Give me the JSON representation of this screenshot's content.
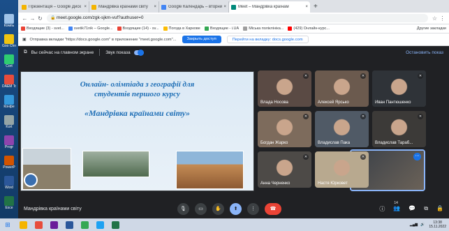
{
  "desktop": {
    "icons": [
      {
        "label": "Компь",
        "color": "#9fc3e8"
      },
      {
        "label": "Goo Chro",
        "color": "#f1c40f"
      },
      {
        "label": "Cort",
        "color": "#2ecc71"
      },
      {
        "label": "DAEM Tool",
        "color": "#e74c3c"
      },
      {
        "label": "Конфе",
        "color": "#3498db"
      },
      {
        "label": "Kort",
        "color": "#95a5a6"
      },
      {
        "label": "Progr",
        "color": "#8e44ad"
      },
      {
        "label": "PowerP",
        "color": "#d35400"
      },
      {
        "label": "Word",
        "color": "#2b579a"
      },
      {
        "label": "Exce",
        "color": "#217346"
      }
    ]
  },
  "browser": {
    "tabs": [
      {
        "label": "Презентація – Google Диск",
        "color": "#f4b400",
        "active": false
      },
      {
        "label": "Мандрівка країнами світу",
        "color": "#f4b400",
        "active": false
      },
      {
        "label": "Google Календарь – вторник, 15 ...",
        "color": "#4285f4",
        "active": false
      },
      {
        "label": "Meet – Мандрівка країнам",
        "color": "#00897b",
        "active": true
      }
    ],
    "url": "meet.google.com/zgk-sjkm-vuf?authuser=0",
    "bookmarks": [
      {
        "label": "Входящие (3) - svet...",
        "color": "#ea4335"
      },
      {
        "label": "svetik71nik – Google...",
        "color": "#4285f4"
      },
      {
        "label": "Входящие (14) - sv...",
        "color": "#ea4335"
      },
      {
        "label": "Погода в Харкове",
        "color": "#fbbc05"
      },
      {
        "label": "Входящие - i.UA",
        "color": "#34a853"
      },
      {
        "label": "Міська поліклініка...",
        "color": "#9e9e9e"
      },
      {
        "label": "(429) Онлайн-курс...",
        "color": "#ff0000"
      }
    ],
    "bookmarks_other": "Другие закладки",
    "infobar": {
      "text": "Отправка вкладки \"https://docs.google.com\" в приложение \"meet.google.com\"...",
      "primary": "Закрыть доступ",
      "secondary": "Перейти на вкладку: docs.google.com"
    }
  },
  "meet": {
    "presenting_label": "Вы сейчас на главном экране",
    "sound_label": "Звук показа",
    "stop_label": "Остановить показ",
    "slide": {
      "line1": "Онлайн- олімпіада з географії для",
      "line2": "студентів першого курсу",
      "line3": "«Мандрівка країнами світу»"
    },
    "participants": [
      {
        "name": "Влада Носова",
        "color": "#5a4a44"
      },
      {
        "name": "Алексей Ярсько",
        "color": "#6b5a4e"
      },
      {
        "name": "Иван Пантюшенко",
        "color": "#2f3338"
      },
      {
        "name": "Богдан Жарко",
        "color": "#7d6b5c"
      },
      {
        "name": "Владислав Пака",
        "color": "#505a66"
      },
      {
        "name": "Владислав Тараб...",
        "color": "#3c3a38"
      },
      {
        "name": "Анна Черненко",
        "color": "#4d4a47"
      },
      {
        "name": "Настя Юрковет",
        "color": "#b8a98f"
      }
    ],
    "self_name": "Вы",
    "meeting_name": "Мандрівка країнами світу",
    "people_count": "14"
  },
  "taskbar": {
    "time": "13:38",
    "date": "15.11.2022",
    "apps": [
      "#f4b400",
      "#e74c3c",
      "#6a1b9a",
      "#2b579a",
      "#34a853",
      "#1da1f2",
      "#217346"
    ]
  }
}
